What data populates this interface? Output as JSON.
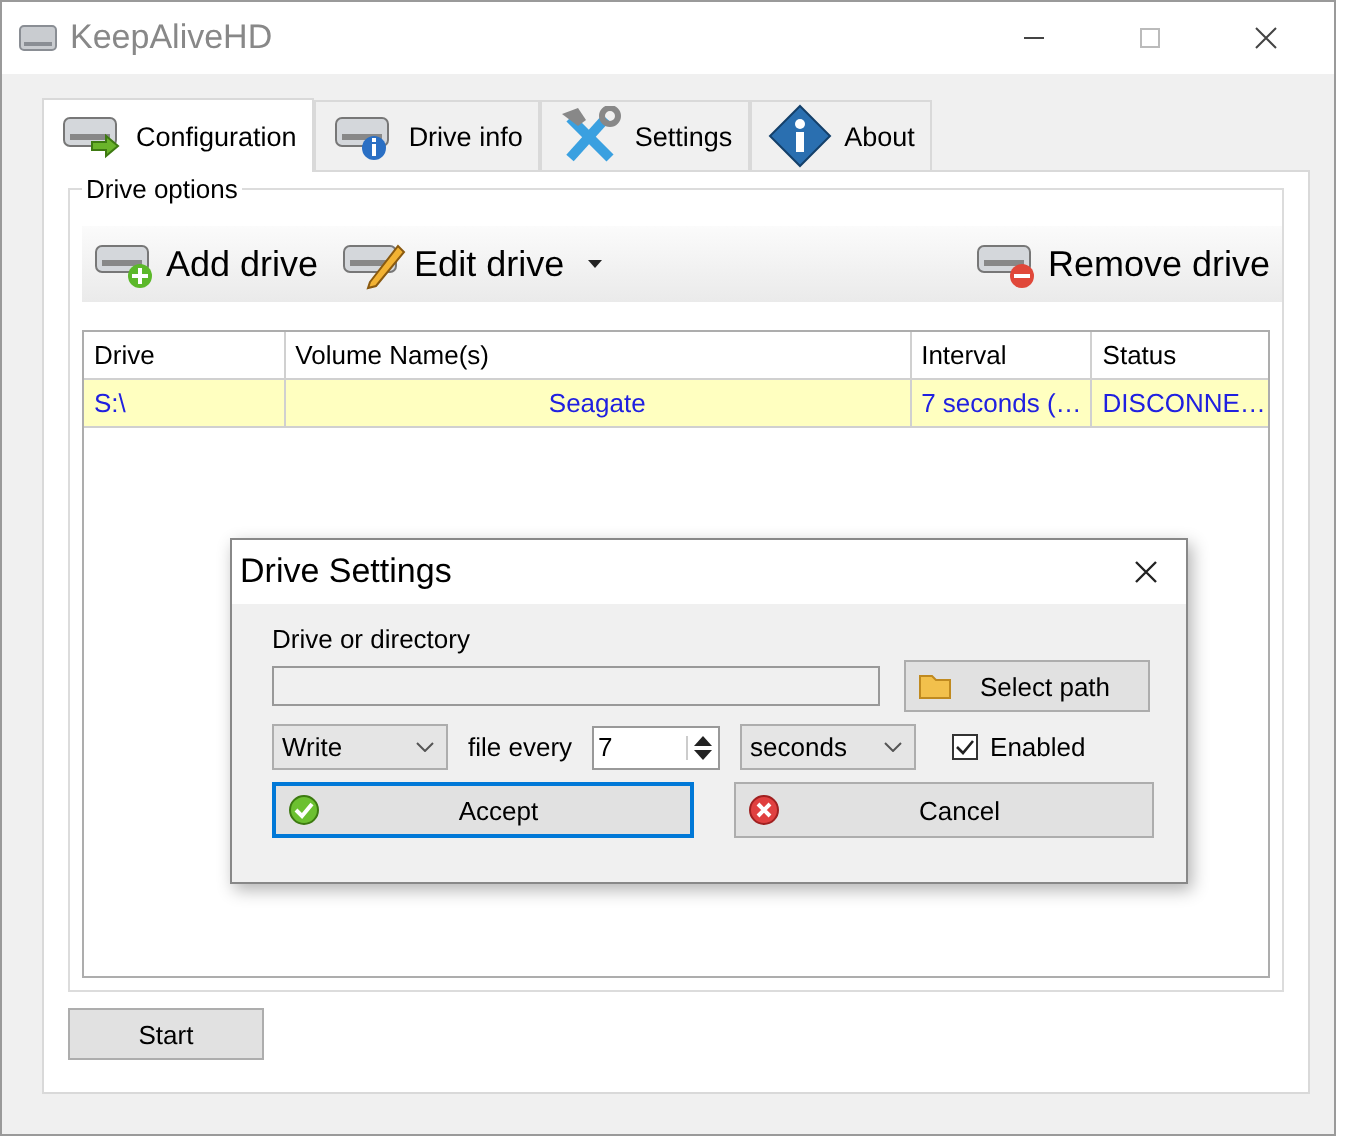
{
  "window": {
    "title": "KeepAliveHD"
  },
  "tabs": [
    {
      "label": "Configuration",
      "selected": true
    },
    {
      "label": "Drive info",
      "selected": false
    },
    {
      "label": "Settings",
      "selected": false
    },
    {
      "label": "About",
      "selected": false
    }
  ],
  "drive_options": {
    "title": "Drive options",
    "toolbar": [
      {
        "label": "Add drive",
        "dropdown": false
      },
      {
        "label": "Edit drive",
        "dropdown": true
      },
      {
        "label": "Remove drive",
        "dropdown": false
      }
    ]
  },
  "table": {
    "columns": [
      "Drive",
      "Volume Name(s)",
      "Interval",
      "Status"
    ],
    "rows": [
      {
        "cells": [
          "S:\\",
          "Seagate",
          "7 seconds (…",
          "DISCONNE…"
        ],
        "selected": true
      }
    ]
  },
  "start_button": "Start",
  "dialog": {
    "title": "Drive Settings",
    "path_label": "Drive or directory",
    "select_path_button": "Select path",
    "action_select": "Write",
    "file_every_label": "file every",
    "interval": "7",
    "unit_select": "seconds",
    "enabled": {
      "label": "Enabled",
      "checked": true
    },
    "accept_button": "Accept",
    "cancel_button": "Cancel"
  }
}
